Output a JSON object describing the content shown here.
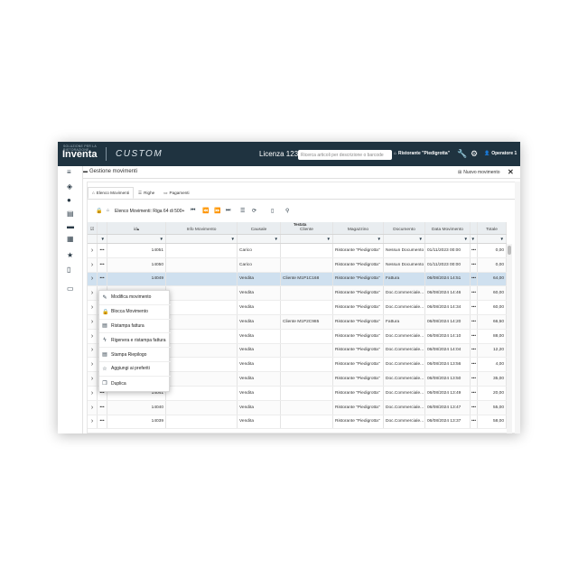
{
  "topbar": {
    "logo_sub": "SOLUZIONE PER LA RISTORAZIONE",
    "logo": "Inventa",
    "brand": "CUSTOM",
    "license": "Licenza 123",
    "search_placeholder": "Ricerca articoli per descrizione o barcode",
    "ristorante": "Ristorante \"Piedigrotta\"",
    "operatore": "Operatore 1"
  },
  "header": {
    "title": "Gestione movimenti",
    "new_button": "Nuovo movimento",
    "close": "✕"
  },
  "tabs": [
    {
      "label": "Elenco Movimenti",
      "icon": "home-icon"
    },
    {
      "label": "Righe",
      "icon": "list-icon"
    },
    {
      "label": "Pagamenti",
      "icon": "card-icon"
    }
  ],
  "toolbar": {
    "breadcrumb": "Elenco Movimenti: Riga 64 di 500+"
  },
  "grid": {
    "group_header": "Testata",
    "columns": [
      "",
      "",
      "id",
      "Info Movimento",
      "Causale",
      "Cliente",
      "Magazzino",
      "Documento",
      "Data Movimento",
      "",
      "Totale"
    ],
    "sort_indicator": "▴",
    "rows": [
      {
        "menu": "•••",
        "id": "14051",
        "info": "",
        "causale": "Carico",
        "cliente": "",
        "magazzino": "Ristorante \"Piedigrotta\"",
        "documento": "Nessun Documento",
        "data": "01/11/2023 00:00",
        "dots": "•••",
        "totale": "0,00"
      },
      {
        "menu": "•••",
        "id": "14050",
        "info": "",
        "causale": "Carico",
        "cliente": "",
        "magazzino": "Ristorante \"Piedigrotta\"",
        "documento": "Nessun Documento",
        "data": "01/11/2023 00:00",
        "dots": "•••",
        "totale": "0,00"
      },
      {
        "menu": "•••",
        "id": "14049",
        "info": "",
        "causale": "Vendita",
        "cliente": "Cliente M1P1C168",
        "magazzino": "Ristorante \"Piedigrotta\"",
        "documento": "Fattura",
        "data": "06/08/2024 14:51",
        "dots": "•••",
        "totale": "64,00"
      },
      {
        "menu": "",
        "id": "",
        "info": "",
        "causale": "Vendita",
        "cliente": "",
        "magazzino": "Ristorante \"Piedigrotta\"",
        "documento": "Doc.Commerciale...",
        "data": "06/08/2024 14:46",
        "dots": "•••",
        "totale": "60,00"
      },
      {
        "menu": "",
        "id": "",
        "info": "",
        "causale": "Vendita",
        "cliente": "",
        "magazzino": "Ristorante \"Piedigrotta\"",
        "documento": "Doc.Commerciale...",
        "data": "06/08/2024 14:34",
        "dots": "•••",
        "totale": "60,00"
      },
      {
        "menu": "",
        "id": "",
        "info": "",
        "causale": "Vendita",
        "cliente": "Cliente M1P2C985",
        "magazzino": "Ristorante \"Piedigrotta\"",
        "documento": "Fattura",
        "data": "06/08/2024 14:20",
        "dots": "•••",
        "totale": "66,50"
      },
      {
        "menu": "",
        "id": "",
        "info": "",
        "causale": "Vendita",
        "cliente": "",
        "magazzino": "Ristorante \"Piedigrotta\"",
        "documento": "Doc.Commerciale...",
        "data": "06/08/2024 14:10",
        "dots": "•••",
        "totale": "88,00"
      },
      {
        "menu": "",
        "id": "",
        "info": "",
        "causale": "Vendita",
        "cliente": "",
        "magazzino": "Ristorante \"Piedigrotta\"",
        "documento": "Doc.Commerciale...",
        "data": "06/08/2024 14:04",
        "dots": "•••",
        "totale": "12,20"
      },
      {
        "menu": "",
        "id": "",
        "info": "",
        "causale": "Vendita",
        "cliente": "",
        "magazzino": "Ristorante \"Piedigrotta\"",
        "documento": "Doc.Commerciale...",
        "data": "06/08/2024 13:56",
        "dots": "•••",
        "totale": "4,00"
      },
      {
        "menu": "",
        "id": "",
        "info": "",
        "causale": "Vendita",
        "cliente": "",
        "magazzino": "Ristorante \"Piedigrotta\"",
        "documento": "Doc.Commerciale...",
        "data": "06/08/2024 13:50",
        "dots": "•••",
        "totale": "35,00"
      },
      {
        "menu": "•••",
        "id": "14041",
        "info": "",
        "causale": "Vendita",
        "cliente": "",
        "magazzino": "Ristorante \"Piedigrotta\"",
        "documento": "Doc.Commerciale...",
        "data": "06/08/2024 13:49",
        "dots": "•••",
        "totale": "20,00"
      },
      {
        "menu": "•••",
        "id": "14040",
        "info": "",
        "causale": "Vendita",
        "cliente": "",
        "magazzino": "Ristorante \"Piedigrotta\"",
        "documento": "Doc.Commerciale...",
        "data": "06/08/2024 13:47",
        "dots": "•••",
        "totale": "55,00"
      },
      {
        "menu": "•••",
        "id": "14039",
        "info": "",
        "causale": "Vendita",
        "cliente": "",
        "magazzino": "Ristorante \"Piedigrotta\"",
        "documento": "Doc.Commerciale...",
        "data": "06/08/2024 13:37",
        "dots": "•••",
        "totale": "58,00"
      }
    ]
  },
  "context_menu": [
    {
      "label": "Modifica movimento",
      "icon": "pencil-icon"
    },
    {
      "label": "Blocca Movimento",
      "icon": "lock-icon"
    },
    {
      "label": "Ristampa fattura",
      "icon": "printer-icon"
    },
    {
      "label": "Rigenera e ristampa fattura",
      "icon": "bolt-icon"
    },
    {
      "label": "Stampa Riepilogo",
      "icon": "printer-icon"
    },
    {
      "label": "Aggiungi ai preferiti",
      "icon": "star-icon"
    },
    {
      "label": "Duplica",
      "icon": "copy-icon"
    }
  ],
  "colors": {
    "topbar": "#1f3340",
    "selected_row": "#cfe0ef",
    "header_bg": "#e9edf0"
  }
}
